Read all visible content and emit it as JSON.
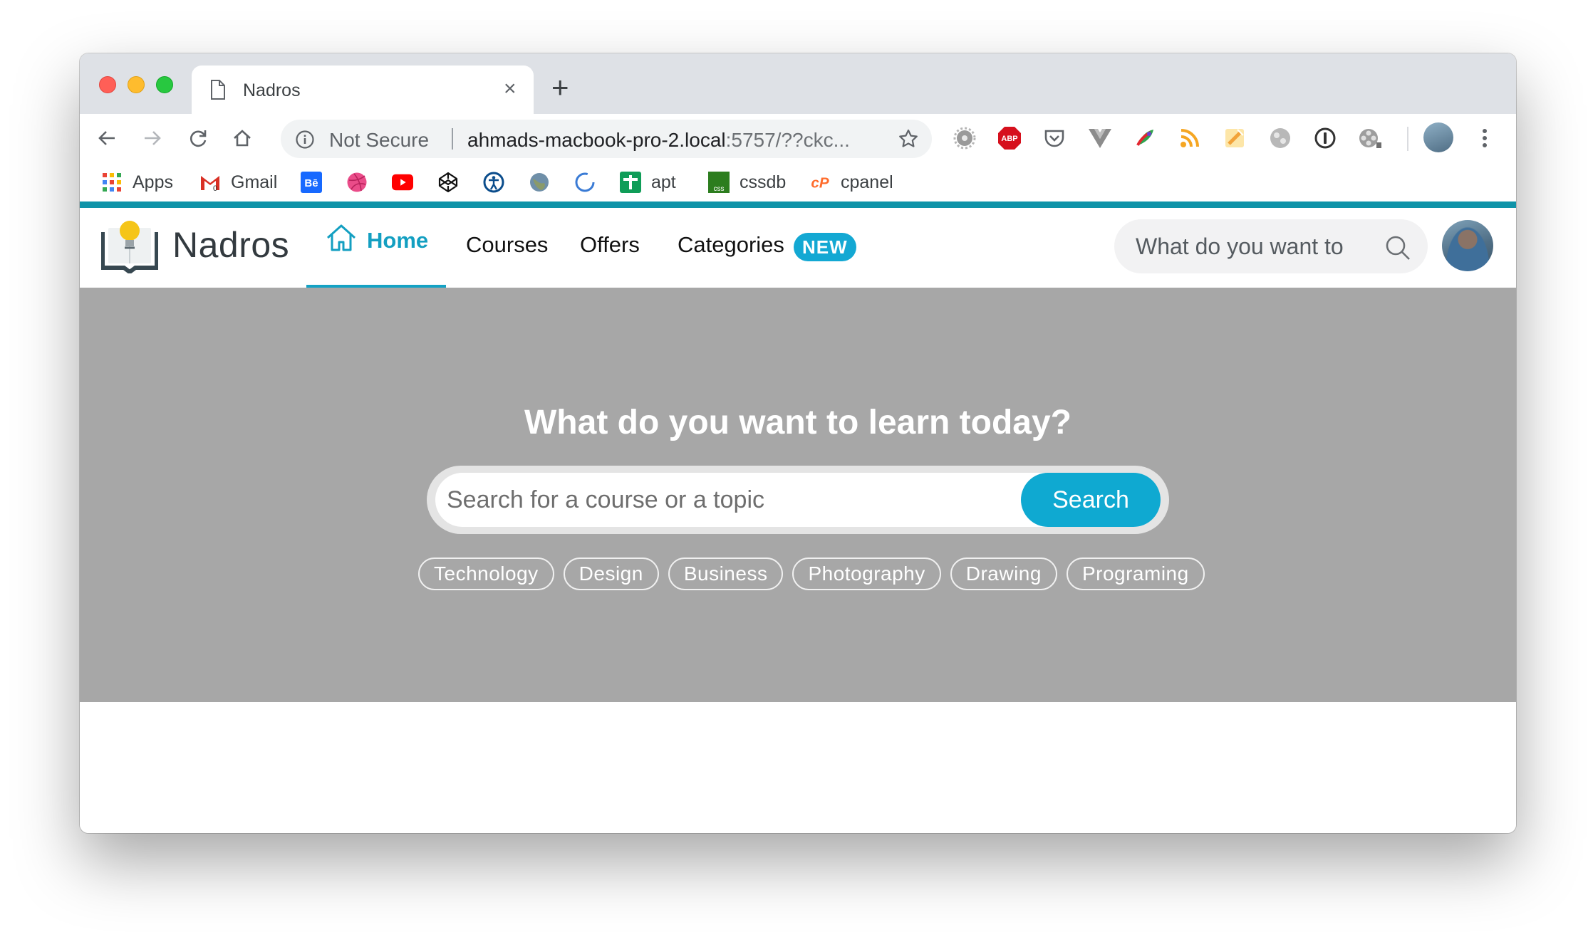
{
  "browser": {
    "tab": {
      "title": "Nadros",
      "close": "×"
    },
    "new_tab": "+",
    "omnibox": {
      "security_label": "Not Secure",
      "url_host": "ahmads-macbook-pro-2.local",
      "url_rest": ":5757/??ckc..."
    },
    "bookmarks": [
      {
        "label": "Apps"
      },
      {
        "label": "Gmail"
      },
      {
        "label": "apt"
      },
      {
        "label": "cssdb"
      },
      {
        "label": "cpanel"
      }
    ],
    "extension_icons": [
      "settings-gear",
      "adblock-plus",
      "pocket",
      "vue-devtools",
      "colorful-extension",
      "rss",
      "sketch-highlighter",
      "globe-grey",
      "1password",
      "film-reel"
    ],
    "colors": {
      "tabstrip": "#dee1e6",
      "omnibox": "#f1f3f4"
    }
  },
  "site": {
    "brand": "Nadros",
    "nav": {
      "home": "Home",
      "courses": "Courses",
      "offers": "Offers",
      "categories": "Categories",
      "categories_badge": "NEW"
    },
    "header_search": {
      "placeholder": "What do you want to"
    },
    "colors": {
      "accent": "#0f93a8",
      "primary": "#13a8d3",
      "hero_bg": "#a7a7a7"
    }
  },
  "hero": {
    "title": "What do you want to learn today?",
    "search": {
      "placeholder": "Search for a course or a topic",
      "button": "Search"
    },
    "topics": [
      "Technology",
      "Design",
      "Business",
      "Photography",
      "Drawing",
      "Programing"
    ]
  }
}
